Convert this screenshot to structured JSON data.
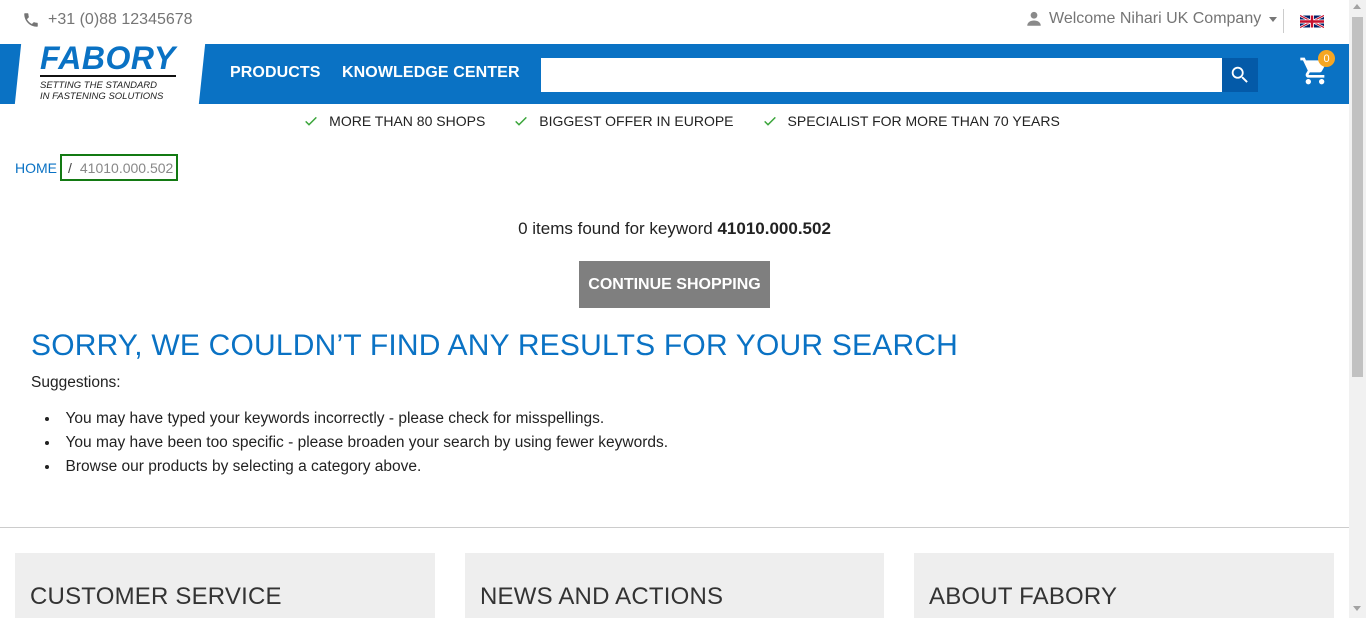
{
  "topbar": {
    "phone": "+31 (0)88 12345678",
    "welcome": "Welcome Nihari UK Company"
  },
  "logo": {
    "title": "FABORY",
    "sub_line1": "SETTING THE STANDARD",
    "sub_line2": "IN FASTENING SOLUTIONS"
  },
  "nav": {
    "products": "PRODUCTS",
    "knowledge": "KNOWLEDGE CENTER",
    "search_value": "",
    "cart_count": "0"
  },
  "usps": [
    "MORE THAN 80 SHOPS",
    "BIGGEST OFFER IN EUROPE",
    "SPECIALIST FOR MORE THAN 70 YEARS"
  ],
  "breadcrumb": {
    "home": "HOME",
    "separator": "/",
    "current": "41010.000.502"
  },
  "results": {
    "found_prefix": "0 items found for keyword",
    "keyword": "41010.000.502",
    "continue_label": "CONTINUE SHOPPING"
  },
  "sorry": {
    "heading": "SORRY, WE COULDN’T FIND ANY RESULTS FOR YOUR SEARCH",
    "suggestions_label": "Suggestions:",
    "items": [
      "You may have typed your keywords incorrectly - please check for misspellings.",
      "You may have been too specific - please broaden your search by using fewer keywords.",
      "Browse our products by selecting a category above."
    ]
  },
  "footer": {
    "customer_service": "CUSTOMER SERVICE",
    "news": "NEWS AND ACTIONS",
    "about": "ABOUT FABORY"
  },
  "colors": {
    "brand_blue": "#0a72c4",
    "button_gray": "#7f7f7f",
    "check_green": "#3aa53a",
    "badge_orange": "#f5a623"
  }
}
